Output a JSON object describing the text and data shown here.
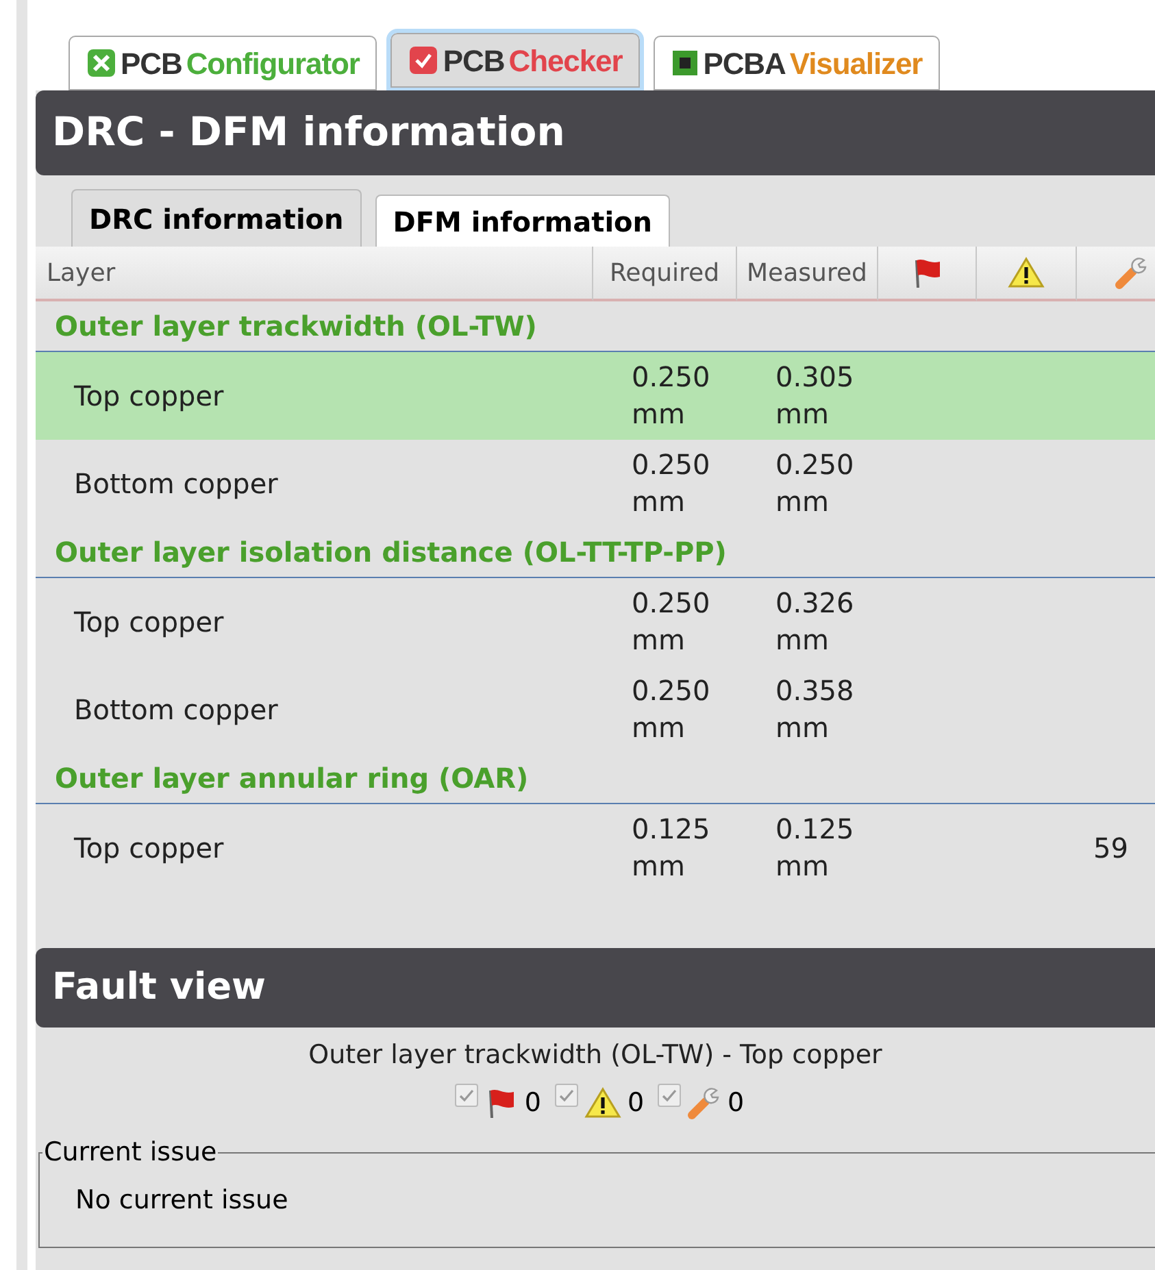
{
  "product_tabs": [
    {
      "brand": "PCB",
      "name": "Configurator",
      "kind": "configurator",
      "color": "#4caf3c",
      "selected": false
    },
    {
      "brand": "PCB",
      "name": "Checker",
      "kind": "checker",
      "color": "#e2444c",
      "selected": true
    },
    {
      "brand": "PCBA",
      "name": "Visualizer",
      "kind": "visualizer",
      "color": "#e08a1e",
      "selected": false
    }
  ],
  "panel": {
    "title": "DRC - DFM information",
    "tabs": [
      {
        "label": "DRC information",
        "selected": true
      },
      {
        "label": "DFM information",
        "selected": false
      }
    ],
    "table": {
      "columns": [
        {
          "kind": "text",
          "label": "Layer"
        },
        {
          "kind": "text",
          "label": "Required"
        },
        {
          "kind": "text",
          "label": "Measured"
        },
        {
          "kind": "flag"
        },
        {
          "kind": "warning"
        },
        {
          "kind": "wrench"
        }
      ],
      "groups": [
        {
          "title": "Outer layer trackwidth (OL-TW)",
          "rows": [
            {
              "layer": "Top copper",
              "required": "0.250 mm",
              "measured": "0.305 mm",
              "selected": true
            },
            {
              "layer": "Bottom copper",
              "required": "0.250 mm",
              "measured": "0.250 mm",
              "selected": false
            }
          ]
        },
        {
          "title": "Outer layer isolation distance (OL-TT-TP-PP)",
          "rows": [
            {
              "layer": "Top copper",
              "required": "0.250 mm",
              "measured": "0.326 mm",
              "selected": false
            },
            {
              "layer": "Bottom copper",
              "required": "0.250 mm",
              "measured": "0.358 mm",
              "selected": false
            }
          ]
        },
        {
          "title": "Outer layer annular ring (OAR)",
          "rows": [
            {
              "layer": "Top copper",
              "required": "0.125 mm",
              "measured": "0.125 mm",
              "column_6": "59",
              "selected": false
            }
          ]
        }
      ]
    }
  },
  "fault_view": {
    "title": "Fault view",
    "subject": "Outer layer trackwidth (OL-TW) - Top copper",
    "filters": [
      {
        "kind": "flag",
        "checked": true,
        "count": "0"
      },
      {
        "kind": "warning",
        "checked": true,
        "count": "0"
      },
      {
        "kind": "wrench",
        "checked": true,
        "count": "0"
      }
    ],
    "current_issue": {
      "legend": "Current issue",
      "text": "No current issue"
    }
  }
}
